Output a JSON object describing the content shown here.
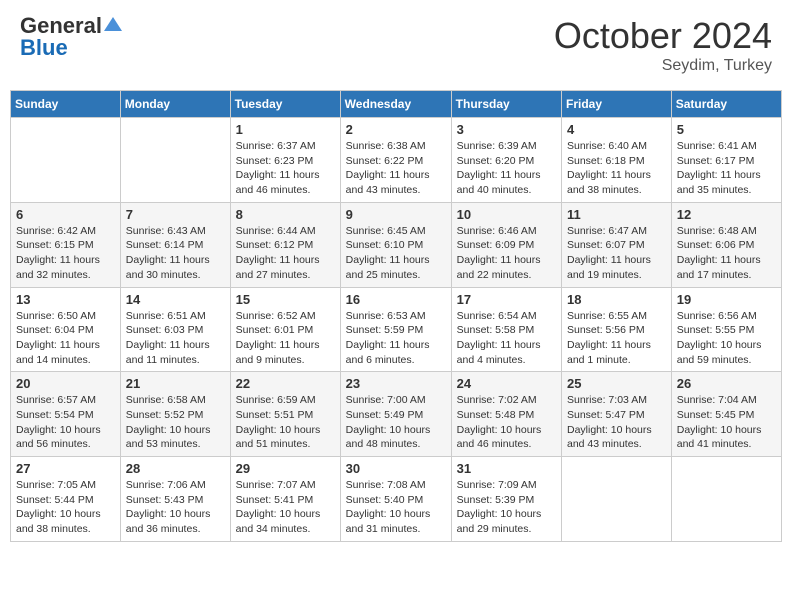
{
  "header": {
    "logo_general": "General",
    "logo_blue": "Blue",
    "month": "October 2024",
    "location": "Seydim, Turkey"
  },
  "days_of_week": [
    "Sunday",
    "Monday",
    "Tuesday",
    "Wednesday",
    "Thursday",
    "Friday",
    "Saturday"
  ],
  "weeks": [
    [
      {
        "day": "",
        "info": ""
      },
      {
        "day": "",
        "info": ""
      },
      {
        "day": "1",
        "info": "Sunrise: 6:37 AM\nSunset: 6:23 PM\nDaylight: 11 hours and 46 minutes."
      },
      {
        "day": "2",
        "info": "Sunrise: 6:38 AM\nSunset: 6:22 PM\nDaylight: 11 hours and 43 minutes."
      },
      {
        "day": "3",
        "info": "Sunrise: 6:39 AM\nSunset: 6:20 PM\nDaylight: 11 hours and 40 minutes."
      },
      {
        "day": "4",
        "info": "Sunrise: 6:40 AM\nSunset: 6:18 PM\nDaylight: 11 hours and 38 minutes."
      },
      {
        "day": "5",
        "info": "Sunrise: 6:41 AM\nSunset: 6:17 PM\nDaylight: 11 hours and 35 minutes."
      }
    ],
    [
      {
        "day": "6",
        "info": "Sunrise: 6:42 AM\nSunset: 6:15 PM\nDaylight: 11 hours and 32 minutes."
      },
      {
        "day": "7",
        "info": "Sunrise: 6:43 AM\nSunset: 6:14 PM\nDaylight: 11 hours and 30 minutes."
      },
      {
        "day": "8",
        "info": "Sunrise: 6:44 AM\nSunset: 6:12 PM\nDaylight: 11 hours and 27 minutes."
      },
      {
        "day": "9",
        "info": "Sunrise: 6:45 AM\nSunset: 6:10 PM\nDaylight: 11 hours and 25 minutes."
      },
      {
        "day": "10",
        "info": "Sunrise: 6:46 AM\nSunset: 6:09 PM\nDaylight: 11 hours and 22 minutes."
      },
      {
        "day": "11",
        "info": "Sunrise: 6:47 AM\nSunset: 6:07 PM\nDaylight: 11 hours and 19 minutes."
      },
      {
        "day": "12",
        "info": "Sunrise: 6:48 AM\nSunset: 6:06 PM\nDaylight: 11 hours and 17 minutes."
      }
    ],
    [
      {
        "day": "13",
        "info": "Sunrise: 6:50 AM\nSunset: 6:04 PM\nDaylight: 11 hours and 14 minutes."
      },
      {
        "day": "14",
        "info": "Sunrise: 6:51 AM\nSunset: 6:03 PM\nDaylight: 11 hours and 11 minutes."
      },
      {
        "day": "15",
        "info": "Sunrise: 6:52 AM\nSunset: 6:01 PM\nDaylight: 11 hours and 9 minutes."
      },
      {
        "day": "16",
        "info": "Sunrise: 6:53 AM\nSunset: 5:59 PM\nDaylight: 11 hours and 6 minutes."
      },
      {
        "day": "17",
        "info": "Sunrise: 6:54 AM\nSunset: 5:58 PM\nDaylight: 11 hours and 4 minutes."
      },
      {
        "day": "18",
        "info": "Sunrise: 6:55 AM\nSunset: 5:56 PM\nDaylight: 11 hours and 1 minute."
      },
      {
        "day": "19",
        "info": "Sunrise: 6:56 AM\nSunset: 5:55 PM\nDaylight: 10 hours and 59 minutes."
      }
    ],
    [
      {
        "day": "20",
        "info": "Sunrise: 6:57 AM\nSunset: 5:54 PM\nDaylight: 10 hours and 56 minutes."
      },
      {
        "day": "21",
        "info": "Sunrise: 6:58 AM\nSunset: 5:52 PM\nDaylight: 10 hours and 53 minutes."
      },
      {
        "day": "22",
        "info": "Sunrise: 6:59 AM\nSunset: 5:51 PM\nDaylight: 10 hours and 51 minutes."
      },
      {
        "day": "23",
        "info": "Sunrise: 7:00 AM\nSunset: 5:49 PM\nDaylight: 10 hours and 48 minutes."
      },
      {
        "day": "24",
        "info": "Sunrise: 7:02 AM\nSunset: 5:48 PM\nDaylight: 10 hours and 46 minutes."
      },
      {
        "day": "25",
        "info": "Sunrise: 7:03 AM\nSunset: 5:47 PM\nDaylight: 10 hours and 43 minutes."
      },
      {
        "day": "26",
        "info": "Sunrise: 7:04 AM\nSunset: 5:45 PM\nDaylight: 10 hours and 41 minutes."
      }
    ],
    [
      {
        "day": "27",
        "info": "Sunrise: 7:05 AM\nSunset: 5:44 PM\nDaylight: 10 hours and 38 minutes."
      },
      {
        "day": "28",
        "info": "Sunrise: 7:06 AM\nSunset: 5:43 PM\nDaylight: 10 hours and 36 minutes."
      },
      {
        "day": "29",
        "info": "Sunrise: 7:07 AM\nSunset: 5:41 PM\nDaylight: 10 hours and 34 minutes."
      },
      {
        "day": "30",
        "info": "Sunrise: 7:08 AM\nSunset: 5:40 PM\nDaylight: 10 hours and 31 minutes."
      },
      {
        "day": "31",
        "info": "Sunrise: 7:09 AM\nSunset: 5:39 PM\nDaylight: 10 hours and 29 minutes."
      },
      {
        "day": "",
        "info": ""
      },
      {
        "day": "",
        "info": ""
      }
    ]
  ]
}
